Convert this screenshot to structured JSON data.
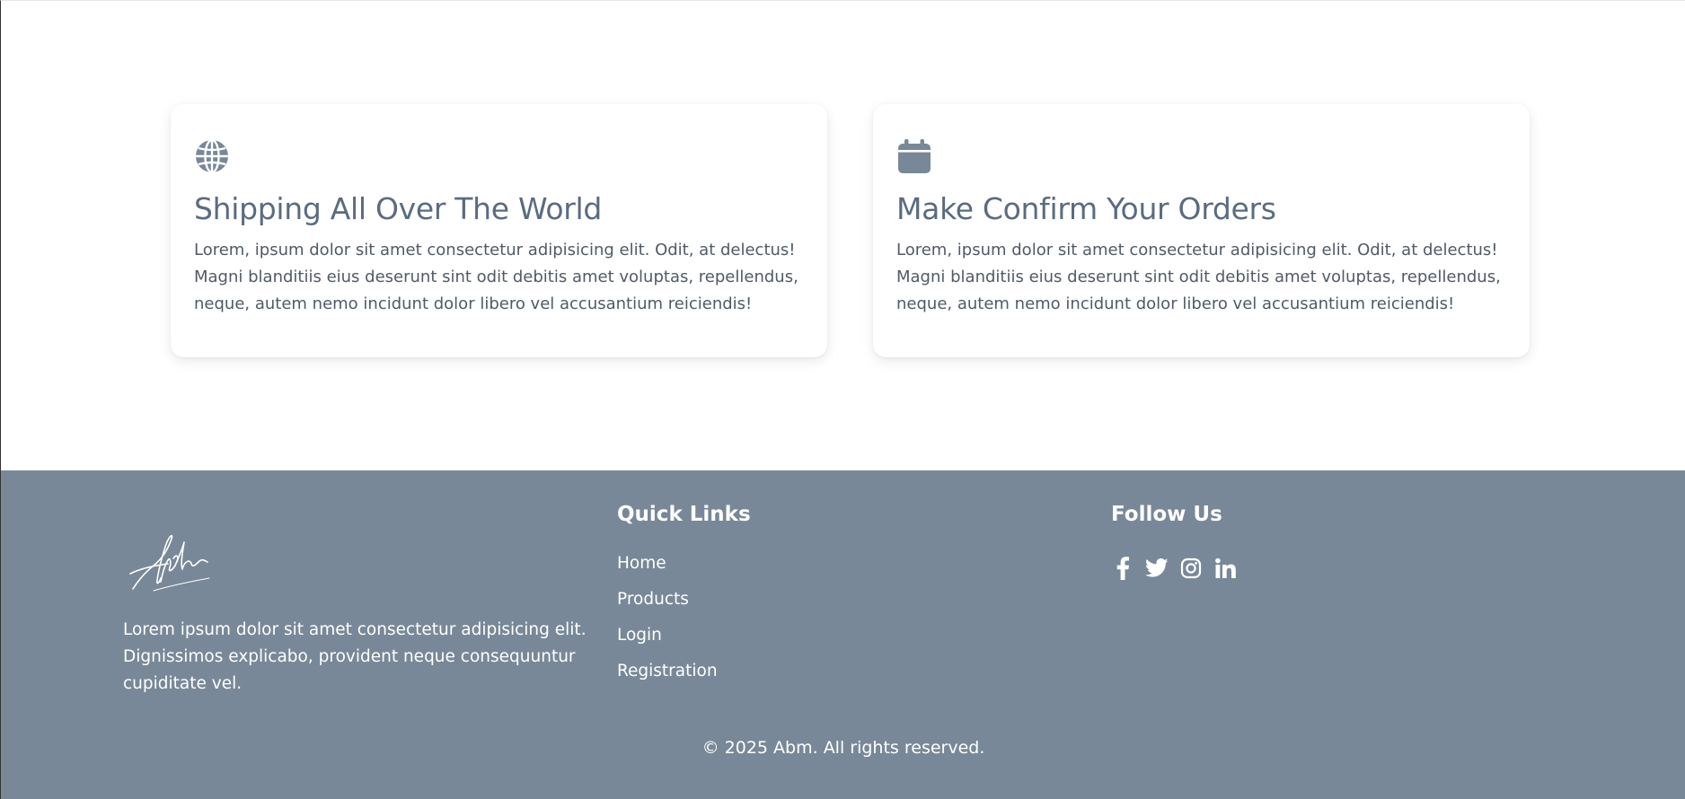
{
  "features": [
    {
      "icon": "globe-icon",
      "title": "Shipping All Over The World",
      "text": "Lorem, ipsum dolor sit amet consectetur adipisicing elit. Odit, at delectus! Magni blanditiis eius deserunt sint odit debitis amet voluptas, repellendus, neque, autem nemo incidunt dolor libero vel accusantium reiciendis!"
    },
    {
      "icon": "calendar-icon",
      "title": "Make Confirm Your Orders",
      "text": "Lorem, ipsum dolor sit amet consectetur adipisicing elit. Odit, at delectus! Magni blanditiis eius deserunt sint odit debitis amet voluptas, repellendus, neque, autem nemo incidunt dolor libero vel accusantium reiciendis!"
    }
  ],
  "footer": {
    "logo_icon": "signature-logo",
    "about": "Lorem ipsum dolor sit amet consectetur adipisicing elit. Dignissimos explicabo, provident neque consequuntur cupiditate vel.",
    "quick_links_title": "Quick Links",
    "quick_links": [
      "Home",
      "Products",
      "Login",
      "Registration"
    ],
    "follow_title": "Follow Us",
    "socials": [
      "facebook-icon",
      "twitter-icon",
      "instagram-icon",
      "linkedin-icon"
    ],
    "copyright": "© 2025 Abm. All rights reserved."
  },
  "colors": {
    "footer_bg": "#788898",
    "heading": "#5b6b80",
    "icon": "#788898",
    "body_text": "#505a66"
  }
}
